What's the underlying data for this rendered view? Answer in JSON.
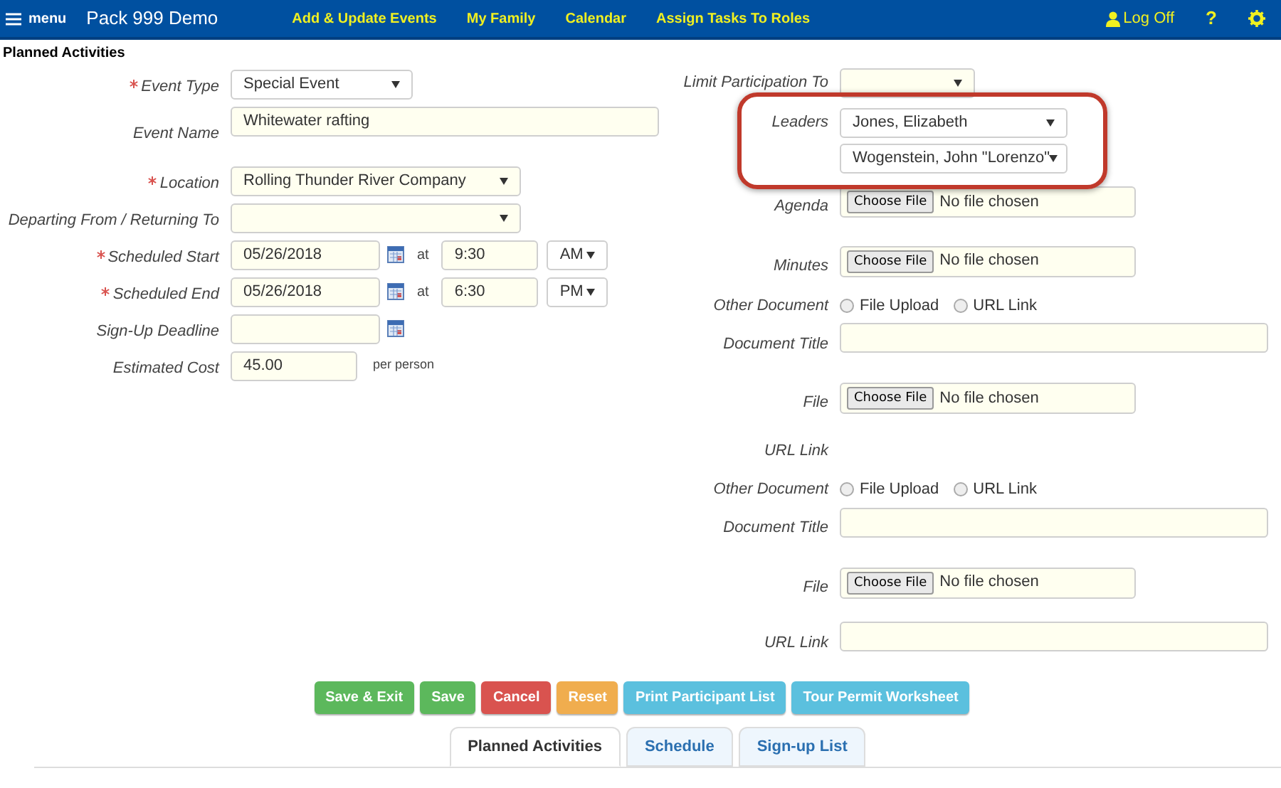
{
  "header": {
    "menu": "menu",
    "title": "Pack 999 Demo",
    "nav": [
      "Add & Update Events",
      "My Family",
      "Calendar",
      "Assign Tasks To Roles"
    ],
    "logoff": "Log Off",
    "help": "?"
  },
  "page_title": "Planned Activities",
  "left_fields": [
    {
      "kind": "select",
      "label": "Event Type",
      "required": true,
      "value": "Special Event"
    },
    {
      "kind": "text_wide",
      "label": "Event Name",
      "required": false,
      "value": "Whitewater rafting"
    },
    {
      "kind": "select_wide",
      "label": "Location",
      "required": true,
      "value": "Rolling Thunder River Company"
    },
    {
      "kind": "select_wide",
      "label": "Departing From / Returning To",
      "required": false
    },
    {
      "kind": "datetime",
      "label": "Scheduled Start",
      "required": true,
      "value": "05/26/2018",
      "at": "at",
      "time": "9:30",
      "ampm": "AM"
    },
    {
      "kind": "datetime",
      "label": "Scheduled End",
      "required": true,
      "value": "05/26/2018",
      "at": "at",
      "time": "6:30",
      "ampm": "PM"
    },
    {
      "kind": "date",
      "label": "Sign-Up Deadline",
      "required": false
    },
    {
      "kind": "cost",
      "label": "Estimated Cost",
      "required": false,
      "value": "45.00",
      "suffix": "per person"
    }
  ],
  "right_fields": [
    {
      "kind": "select_small",
      "label": "Limit Participation To"
    },
    {
      "kind": "leaders",
      "label": "Leaders",
      "highlighted": true,
      "values": [
        "Jones, Elizabeth",
        "Wogenstein, John \"Lorenzo\""
      ]
    },
    {
      "kind": "file",
      "label": "Agenda",
      "button": "Choose File",
      "status": "No file chosen"
    },
    {
      "kind": "file",
      "label": "Minutes",
      "button": "Choose File",
      "status": "No file chosen"
    },
    {
      "kind": "radio",
      "label": "Other Document",
      "options": [
        {
          "label": "File Upload",
          "selected": false
        },
        {
          "label": "URL Link",
          "selected": false
        }
      ]
    },
    {
      "kind": "text",
      "label": "Document Title"
    },
    {
      "kind": "file",
      "label": "File",
      "button": "Choose File",
      "status": "No file chosen"
    },
    {
      "kind": "label_only",
      "label": "URL Link"
    },
    {
      "kind": "radio",
      "label": "Other Document",
      "options": [
        {
          "label": "File Upload",
          "selected": false
        },
        {
          "label": "URL Link",
          "selected": false
        }
      ]
    },
    {
      "kind": "text",
      "label": "Document Title"
    },
    {
      "kind": "file",
      "label": "File",
      "button": "Choose File",
      "status": "No file chosen"
    },
    {
      "kind": "url",
      "label": "URL Link"
    }
  ],
  "buttons": [
    {
      "label": "Save & Exit",
      "color": "#5cb85c"
    },
    {
      "label": "Save",
      "color": "#5cb85c"
    },
    {
      "label": "Cancel",
      "color": "#d9534f"
    },
    {
      "label": "Reset",
      "color": "#f0ad4e"
    },
    {
      "label": "Print Participant List",
      "color": "#5bc0de"
    },
    {
      "label": "Tour Permit Worksheet",
      "color": "#5bc0de"
    }
  ],
  "tabs": [
    {
      "label": "Planned Activities",
      "selected": true
    },
    {
      "label": "Schedule",
      "selected": false
    },
    {
      "label": "Sign-up List",
      "selected": false
    }
  ]
}
